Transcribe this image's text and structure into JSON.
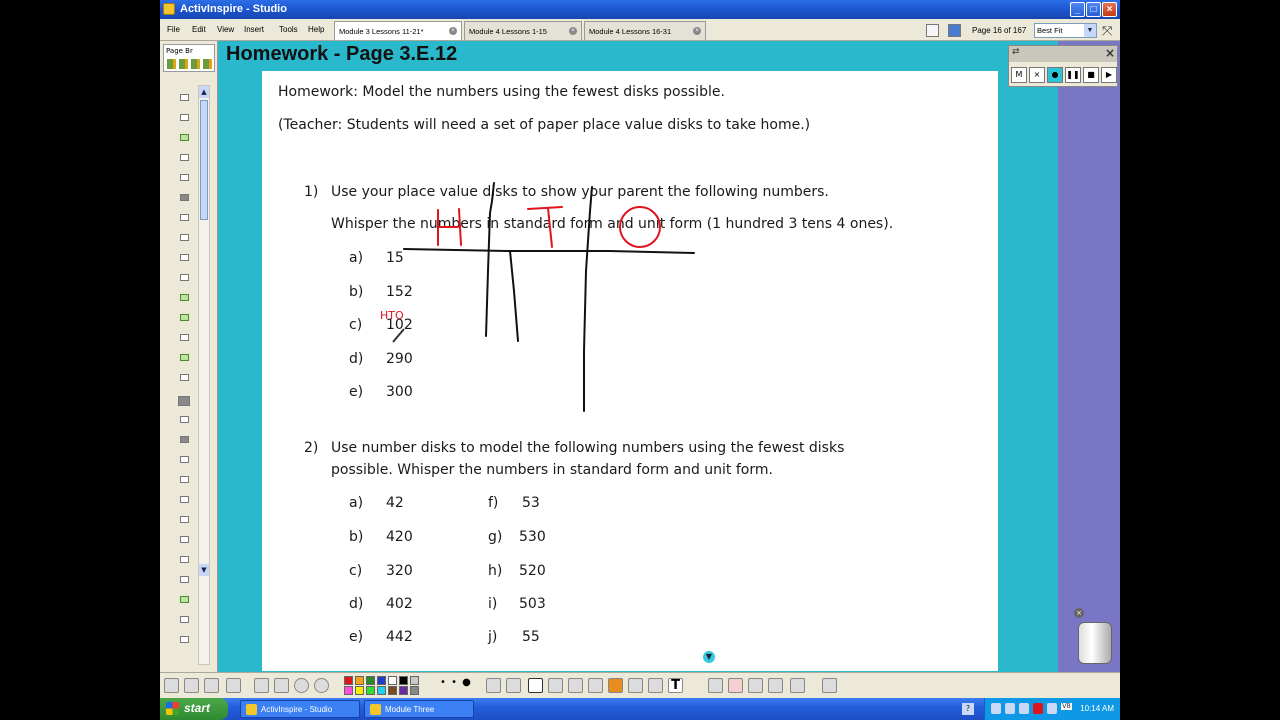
{
  "app": {
    "title": "ActivInspire - Studio"
  },
  "menu": {
    "items": [
      "File",
      "Edit",
      "View",
      "Insert",
      "Tools",
      "Help"
    ]
  },
  "tabs": [
    "Module 3 Lessons 11-21*",
    "Module 4 Lessons 1-15",
    "Module 4 Lessons 16-31"
  ],
  "pager": {
    "page_label": "Page 16 of 167",
    "zoom": "Best Fit"
  },
  "sidebar": {
    "title": "Page Br"
  },
  "page": {
    "heading": "Homework - Page 3.E.12",
    "homework": "Homework:  Model the numbers using the fewest disks possible.",
    "teacher": "(Teacher:  Students will need a set of paper place value disks to take home.)",
    "q1": {
      "number": "1)",
      "line1": "Use your place value disks to show your parent the following numbers.",
      "line2": "Whisper the numbers in standard form and unit form (1 hundred 3 tens 4 ones).",
      "items": [
        {
          "letter": "a)",
          "value": "15"
        },
        {
          "letter": "b)",
          "value": "152"
        },
        {
          "letter": "c)",
          "value": "102"
        },
        {
          "letter": "d)",
          "value": "290"
        },
        {
          "letter": "e)",
          "value": "300"
        }
      ]
    },
    "q2": {
      "number": "2)",
      "line1": "Use number disks to model the following numbers using the fewest disks",
      "line2": "possible.  Whisper the numbers in standard form and unit form.",
      "left": [
        {
          "letter": "a)",
          "value": "42"
        },
        {
          "letter": "b)",
          "value": "420"
        },
        {
          "letter": "c)",
          "value": "320"
        },
        {
          "letter": "d)",
          "value": "402"
        },
        {
          "letter": "e)",
          "value": "442"
        }
      ],
      "right": [
        {
          "letter": "f)",
          "value": "53"
        },
        {
          "letter": "g)",
          "value": "530"
        },
        {
          "letter": "h)",
          "value": "520"
        },
        {
          "letter": "i)",
          "value": "503"
        },
        {
          "letter": "j)",
          "value": "55"
        }
      ]
    },
    "annotations": {
      "chart_headers": [
        "H",
        "T",
        "O"
      ],
      "small_label": "HTO",
      "ink_color": "#e0141c"
    }
  },
  "recorder": {
    "buttons": [
      "M",
      "×"
    ]
  },
  "taskbar": {
    "start": "start",
    "tasks": [
      "ActivInspire - Studio",
      "Module Three"
    ],
    "tray_label": "V8",
    "clock": "10:14 AM"
  }
}
